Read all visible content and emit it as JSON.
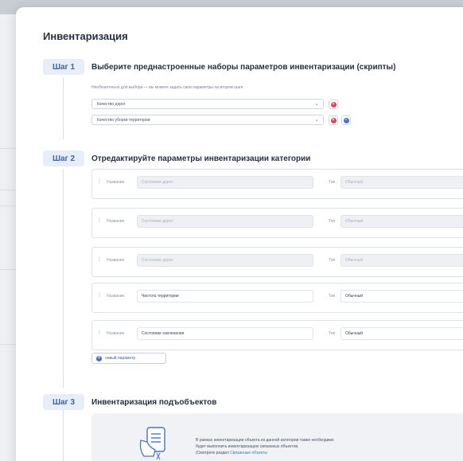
{
  "modal": {
    "title": "Инвентаризация"
  },
  "step1": {
    "badge": "Шаг 1",
    "title": "Выберите преднастроенные наборы параметров инвентаризации (скрипты)",
    "hint": "Необязательно для выбора — вы можете задать свои параметры на втором шаге.",
    "selects": [
      {
        "value": "Качество дорог"
      },
      {
        "value": "Качество уборки территории"
      }
    ]
  },
  "step2": {
    "badge": "Шаг 2",
    "title": "Отредактируйте параметры инвентаризации категории",
    "name_label": "Название",
    "type_label": "Тип",
    "params": [
      {
        "name": "Состояние дорог",
        "type": "Обычный",
        "disabled": true
      },
      {
        "name": "Состояние дорог",
        "type": "Обычный",
        "disabled": true
      },
      {
        "name": "Состояние дорог",
        "type": "Обычный",
        "disabled": true
      },
      {
        "name": "Чистота территории",
        "type": "Обычный",
        "disabled": false
      },
      {
        "name": "Состояние озеленения",
        "type": "Обычный",
        "disabled": false
      }
    ],
    "add_label": "новый параметр"
  },
  "step3": {
    "badge": "Шаг 3",
    "title": "Инвентаризация подъобъектов",
    "text_line1": "В рамках инвентаризации объекта из данной категории также необходимо",
    "text_line2": "будет выполнить инвентаризацию связанных объектов.",
    "text_line3": "(Смотрите раздел",
    "text_link": "Связанные объекты"
  },
  "colors": {
    "accent": "#4a73bd",
    "danger": "#d9435b",
    "badge_bg": "#e8eef8"
  },
  "icons": [
    "chevron-down-icon",
    "remove-icon",
    "settings-icon",
    "drag-handle-icon",
    "plus-icon",
    "clipboard-icon"
  ]
}
